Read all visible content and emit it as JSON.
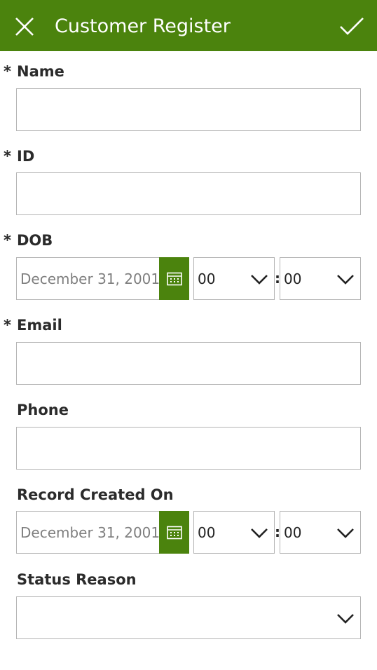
{
  "header": {
    "title": "Customer Register",
    "close_icon": "close-icon",
    "submit_icon": "checkmark-icon",
    "color": "#4b830d"
  },
  "required_marker": "*",
  "fields": {
    "name": {
      "label": "Name",
      "value": ""
    },
    "id": {
      "label": "ID",
      "value": ""
    },
    "dob": {
      "label": "DOB",
      "date_placeholder": "December 31, 2001",
      "hour": "00",
      "minute": "00",
      "separator": ":"
    },
    "email": {
      "label": "Email",
      "value": ""
    },
    "phone": {
      "label": "Phone",
      "value": ""
    },
    "record_created_on": {
      "label": "Record Created On",
      "date_placeholder": "December 31, 2001",
      "hour": "00",
      "minute": "00",
      "separator": ":"
    },
    "status_reason": {
      "label": "Status Reason",
      "value": ""
    }
  }
}
